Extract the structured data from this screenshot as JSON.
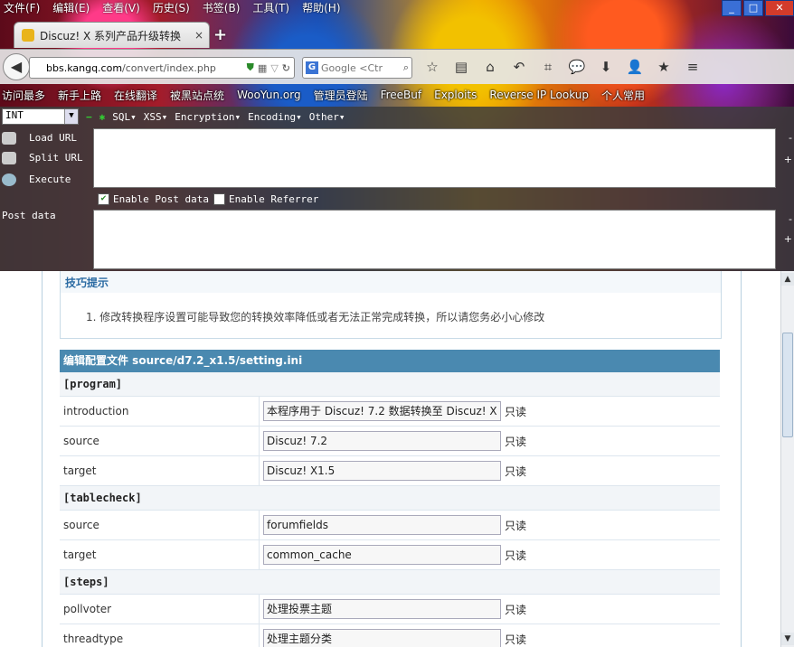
{
  "menubar": [
    "文件(F)",
    "编辑(E)",
    "查看(V)",
    "历史(S)",
    "书签(B)",
    "工具(T)",
    "帮助(H)"
  ],
  "tab": {
    "title": "Discuz! X 系列产品升级转换",
    "close": "×",
    "new": "+"
  },
  "url": {
    "host": "bbs.kangq.com",
    "path": "/convert/index.php"
  },
  "search": {
    "engine": "G",
    "placeholder": "Google <Ctr"
  },
  "bookmarks": [
    "访问最多",
    "新手上路",
    "在线翻译",
    "被黑站点统",
    "WooYun.org",
    "管理员登陆",
    "FreeBuf",
    "Exploits",
    "Reverse IP Lookup",
    "个人常用"
  ],
  "hackbar": {
    "select_value": "INT",
    "menus": [
      "SQL▾",
      "XSS▾",
      "Encryption▾",
      "Encoding▾",
      "Other▾"
    ],
    "load_url": "Load URL",
    "split_url": "Split URL",
    "execute": "Execute",
    "enable_post": "Enable Post data",
    "enable_referrer": "Enable Referrer",
    "post_data_label": "Post data",
    "plus": "+",
    "minus": "-"
  },
  "tips": {
    "title": "技巧提示",
    "item": "1. 修改转换程序设置可能导致您的转换效率降低或者无法正常完成转换，所以请您务必小心修改"
  },
  "config": {
    "heading": "编辑配置文件 source/d7.2_x1.5/setting.ini",
    "readonly": "只读",
    "sections": [
      {
        "name": "[program]",
        "rows": [
          {
            "key": "introduction",
            "value": "本程序用于 Discuz! 7.2 数据转换至 Discuz! X"
          },
          {
            "key": "source",
            "value": "Discuz! 7.2"
          },
          {
            "key": "target",
            "value": "Discuz! X1.5"
          }
        ]
      },
      {
        "name": "[tablecheck]",
        "rows": [
          {
            "key": "source",
            "value": "forumfields"
          },
          {
            "key": "target",
            "value": "common_cache"
          }
        ]
      },
      {
        "name": "[steps]",
        "rows": [
          {
            "key": "pollvoter",
            "value": "处理投票主题"
          },
          {
            "key": "threadtype",
            "value": "处理主题分类"
          }
        ]
      }
    ]
  }
}
